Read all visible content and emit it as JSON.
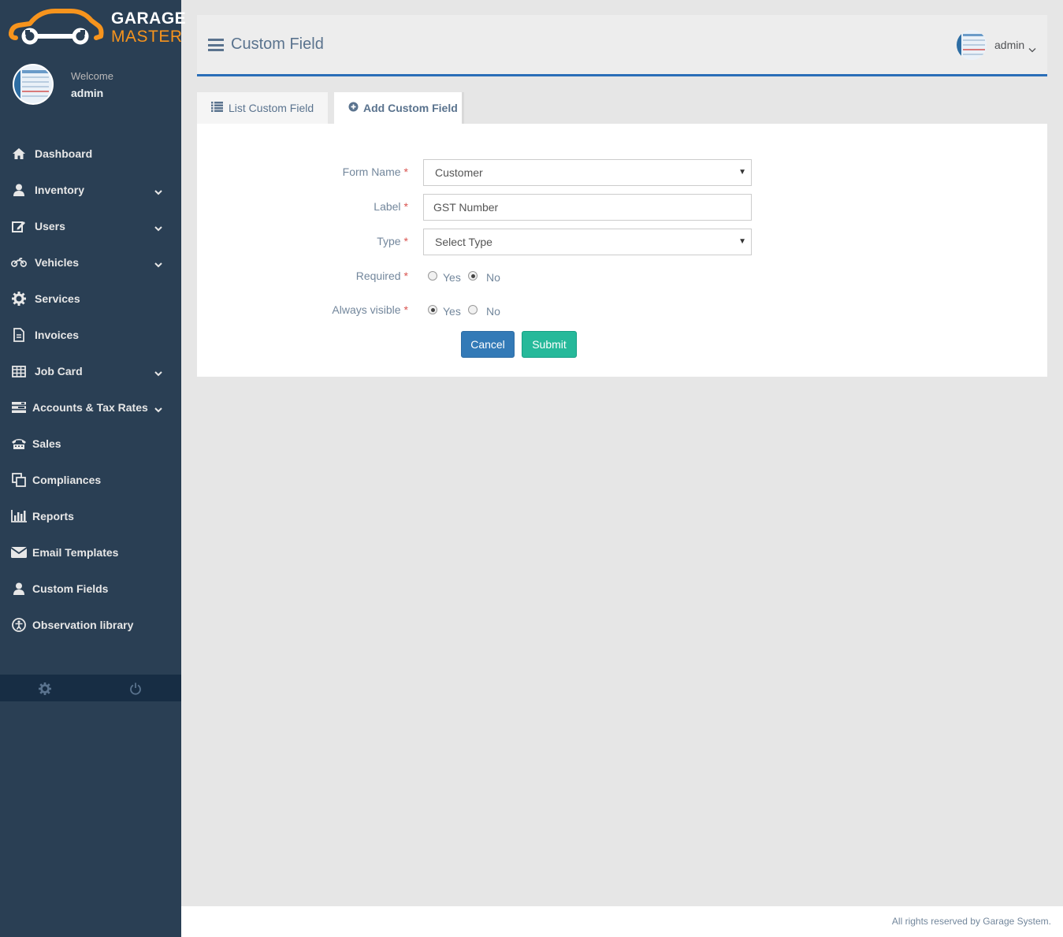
{
  "brand": {
    "line1": "GARAGE",
    "line2": "MASTER",
    "primary_color": "#2a3f54",
    "accent_color": "#f7941d"
  },
  "profile": {
    "welcome": "Welcome",
    "name": "admin"
  },
  "sidebar": {
    "items": [
      {
        "label": "Dashboard",
        "icon": "home-icon",
        "has_submenu": false
      },
      {
        "label": "Inventory",
        "icon": "user-icon",
        "has_submenu": true
      },
      {
        "label": "Users",
        "icon": "edit-icon",
        "has_submenu": true
      },
      {
        "label": "Vehicles",
        "icon": "motorcycle-icon",
        "has_submenu": true
      },
      {
        "label": "Services",
        "icon": "cogs-icon",
        "has_submenu": false
      },
      {
        "label": "Invoices",
        "icon": "file-icon",
        "has_submenu": false
      },
      {
        "label": "Job Card",
        "icon": "table-icon",
        "has_submenu": true
      },
      {
        "label": "Accounts & Tax Rates",
        "icon": "tasks-icon",
        "has_submenu": true
      },
      {
        "label": "Sales",
        "icon": "tty-icon",
        "has_submenu": false
      },
      {
        "label": "Compliances",
        "icon": "clone-icon",
        "has_submenu": false
      },
      {
        "label": "Reports",
        "icon": "bar-chart-icon",
        "has_submenu": false
      },
      {
        "label": "Email Templates",
        "icon": "envelope-icon",
        "has_submenu": false
      },
      {
        "label": "Custom Fields",
        "icon": "user-icon",
        "has_submenu": false
      },
      {
        "label": "Observation library",
        "icon": "universal-access-icon",
        "has_submenu": false
      }
    ],
    "footer": {
      "settings_icon": "gear-icon",
      "logout_icon": "power-icon"
    }
  },
  "header": {
    "title": "Custom Field",
    "user": "admin"
  },
  "tabs": [
    {
      "label": "List Custom Field",
      "icon": "list-icon",
      "active": false
    },
    {
      "label": "Add Custom Field",
      "icon": "plus-circle-icon",
      "active": true
    }
  ],
  "form": {
    "form_name": {
      "label": "Form Name",
      "value": "Customer"
    },
    "field_label": {
      "label": "Label",
      "value": "GST Number"
    },
    "type": {
      "label": "Type",
      "value": "Select Type"
    },
    "required": {
      "label": "Required",
      "yes": "Yes",
      "no": "No",
      "selected": "No"
    },
    "always_visible": {
      "label": "Always visible",
      "yes": "Yes",
      "no": "No",
      "selected": "Yes"
    },
    "required_marker": "*",
    "cancel": "Cancel",
    "submit": "Submit"
  },
  "footer": {
    "text": "All rights reserved by Garage System."
  }
}
